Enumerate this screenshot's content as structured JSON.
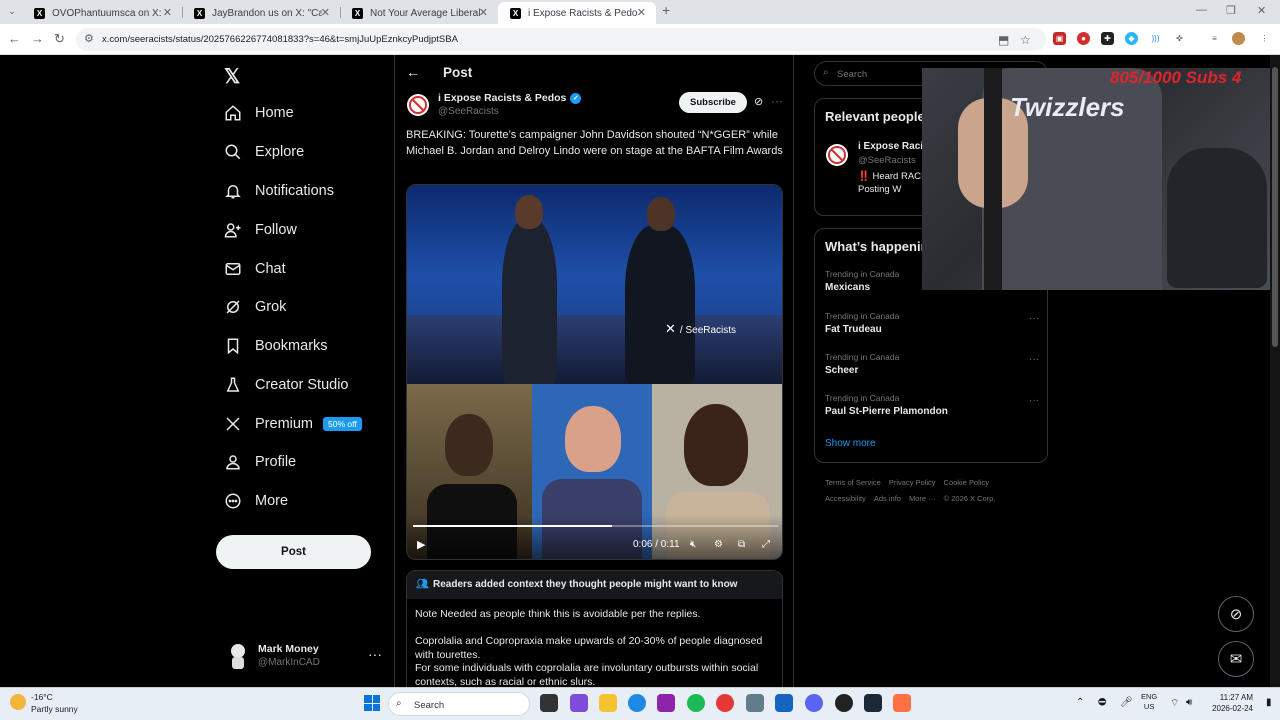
{
  "browser": {
    "tabs": [
      {
        "title": "OVOPhantuumsca on X: \"Can't",
        "active": false
      },
      {
        "title": "JayBrandon us on X: \"Canada h",
        "active": false
      },
      {
        "title": "Not Your Average Liberal on X",
        "active": false
      },
      {
        "title": "i Expose Racists & Pedos on X:",
        "active": true
      }
    ],
    "url": "x.com/seeracists/status/2025766226774081833?s=46&t=smjJuUpEznkcyPudjptSBA"
  },
  "sidebar": {
    "items": [
      {
        "label": "Home",
        "icon": "home-icon"
      },
      {
        "label": "Explore",
        "icon": "search-icon"
      },
      {
        "label": "Notifications",
        "icon": "bell-icon"
      },
      {
        "label": "Follow",
        "icon": "person-plus-icon"
      },
      {
        "label": "Chat",
        "icon": "mail-icon"
      },
      {
        "label": "Grok",
        "icon": "grok-icon"
      },
      {
        "label": "Bookmarks",
        "icon": "bookmark-icon"
      },
      {
        "label": "Creator Studio",
        "icon": "flask-icon"
      },
      {
        "label": "Premium",
        "icon": "x-logo-icon",
        "badge": "50% off"
      },
      {
        "label": "Profile",
        "icon": "person-icon"
      },
      {
        "label": "More",
        "icon": "more-circle-icon"
      }
    ],
    "post_button": "Post",
    "account": {
      "name": "Mark Money",
      "handle": "@MarkInCAD"
    }
  },
  "post": {
    "header": "Post",
    "author": {
      "name": "i Expose Racists & Pedos",
      "handle": "@SeeRacists"
    },
    "subscribe": "Subscribe",
    "text": "BREAKING: Tourette’s campaigner John Davidson shouted “N*GGER” while Michael B. Jordan and Delroy Lindo were on stage at the BAFTA Film Awards",
    "video": {
      "watermark": "/ SeeRacists",
      "time": "0:06 / 0:11",
      "progress": 0.545
    },
    "note": {
      "header": "Readers added context they thought people might want to know",
      "paragraphs": [
        "Note Needed as people think this is avoidable per the replies.",
        "Coprolalia and Copropraxia make upwards of 20-30% of people diagnosed with tourettes.",
        "For some individuals with coprolalia are involuntary outbursts within social contexts, such as racial or ethnic slurs."
      ]
    }
  },
  "right": {
    "search_placeholder": "Search",
    "relevant": {
      "title": "Relevant people",
      "name": "i Expose Racists & Pedos",
      "handle": "@SeeRacists",
      "bio": "‼️ Heard RACISM Twitter so I'm Here Posting W"
    },
    "happening": {
      "title": "What’s happening",
      "trends": [
        {
          "context": "Trending in Canada",
          "topic": "Mexicans"
        },
        {
          "context": "Trending in Canada",
          "topic": "Fat Trudeau"
        },
        {
          "context": "Trending in Canada",
          "topic": "Scheer"
        },
        {
          "context": "Trending in Canada",
          "topic": "Paul St-Pierre Plamondon"
        }
      ],
      "show_more": "Show more"
    },
    "footer": [
      "Terms of Service",
      "Privacy Policy",
      "Cookie Policy",
      "Accessibility",
      "Ads info",
      "More ···",
      "© 2026 X Corp."
    ]
  },
  "overlay": {
    "logo": "Twizzlers",
    "sub_goal": "805/1000 Subs 4"
  },
  "taskbar": {
    "weather_temp": "-16°C",
    "weather_desc": "Partly sunny",
    "search_placeholder": "Search",
    "lang_top": "ENG",
    "lang_bottom": "US",
    "time": "11:27 AM",
    "date": "2026-02-24"
  },
  "colors": {
    "accent": "#1d9bf0",
    "background": "#000000",
    "text": "#e7e9ea",
    "muted": "#71767b",
    "border": "#2f3336"
  }
}
